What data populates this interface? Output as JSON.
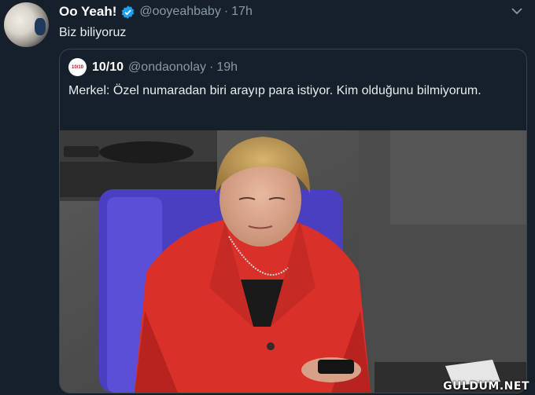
{
  "tweet": {
    "display_name": "Oo Yeah!",
    "handle": "@ooyeahbaby",
    "separator": "·",
    "time": "17h",
    "text": "Biz biliyoruz",
    "verified_icon": "verified-badge-icon",
    "menu_icon": "chevron-down-icon"
  },
  "quote": {
    "avatar_text": "10/10",
    "display_name": "10/10",
    "handle": "@ondaonolay",
    "separator": "·",
    "time": "19h",
    "text": "Merkel: Özel numaradan biri arayıp para istiyor. Kim olduğunu bilmiyorum.",
    "photo": "photo-woman-in-red-jacket-looking-at-phone"
  },
  "watermark": "GULDUM.NET",
  "colors": {
    "background": "#15202b",
    "border": "#38444d",
    "muted_text": "#8899a6",
    "verified": "#1da1f2",
    "jacket": "#d9302a"
  }
}
